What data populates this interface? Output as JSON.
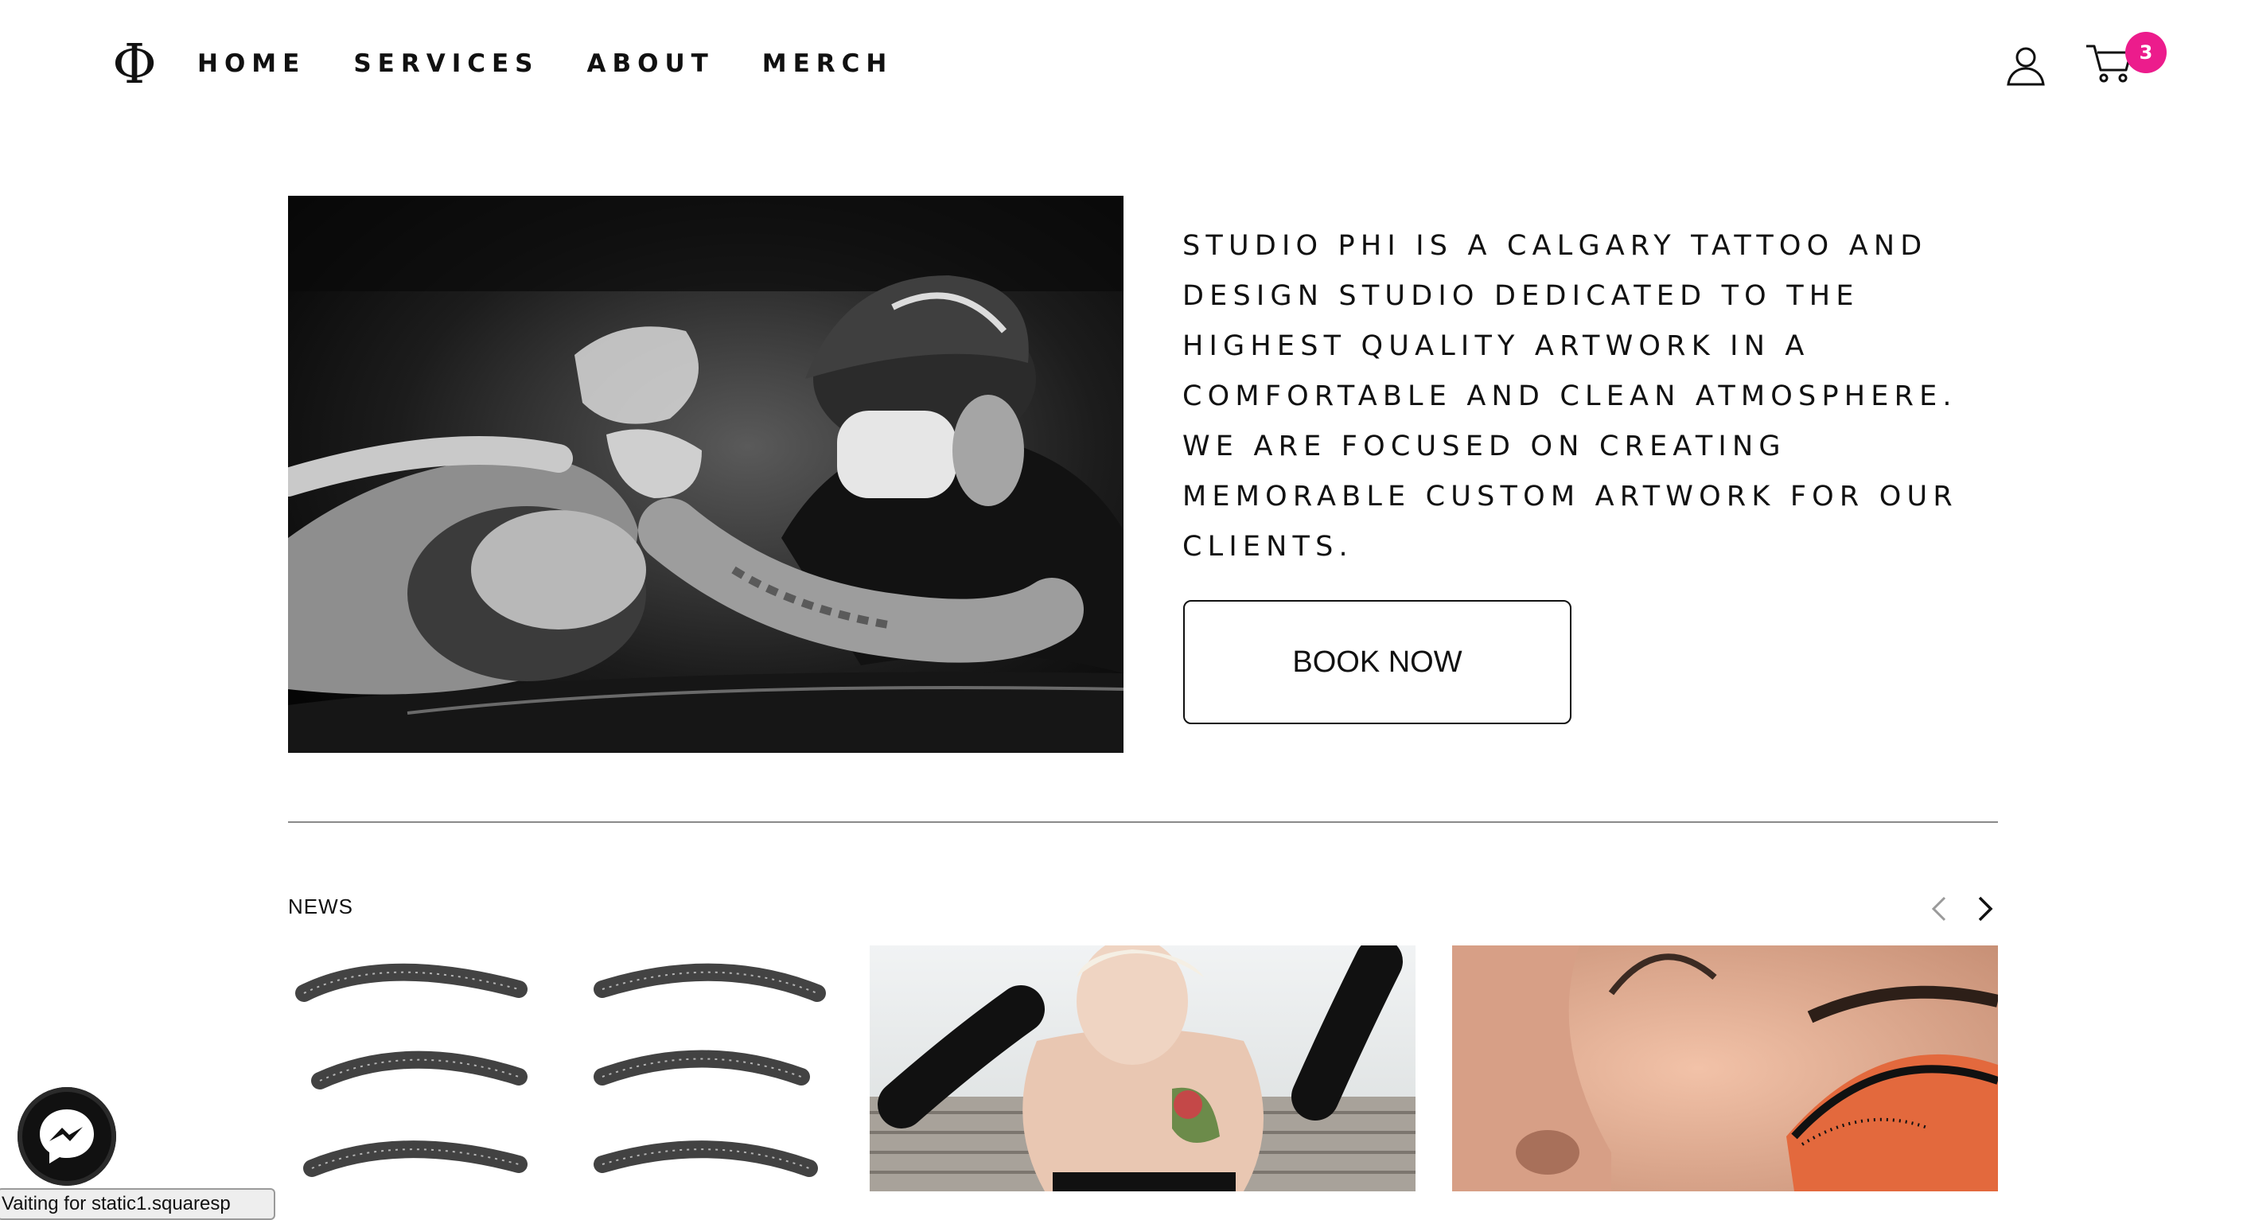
{
  "header": {
    "logo_icon": "phi-logo-icon",
    "nav": [
      {
        "label": "HOME"
      },
      {
        "label": "SERVICES"
      },
      {
        "label": "ABOUT"
      },
      {
        "label": "MERCH"
      }
    ],
    "account_icon": "user-icon",
    "cart_icon": "cart-icon",
    "cart_count": "3",
    "badge_color": "#ec1c8c"
  },
  "hero": {
    "image_icon": "tattoo-artist-photo",
    "about_text": "STUDIO PHI IS A CALGARY TATTOO AND DESIGN STUDIO DEDICATED TO THE HIGHEST QUALITY ARTWORK IN A COMFORTABLE AND CLEAN ATMOSPHERE. WE ARE FOCUSED ON CREATING MEMORABLE CUSTOM ARTWORK FOR OUR CLIENTS.",
    "book_button": "BOOK NOW"
  },
  "news": {
    "label": "NEWS",
    "prev_icon": "chevron-left-icon",
    "next_icon": "chevron-right-icon",
    "cards": [
      {
        "image": "eyebrows-sketch-image"
      },
      {
        "image": "tattooed-woman-image"
      },
      {
        "image": "eye-makeup-image"
      }
    ]
  },
  "widgets": {
    "messenger_icon": "messenger-icon",
    "status_text": "Vaiting for static1.squaresp"
  }
}
